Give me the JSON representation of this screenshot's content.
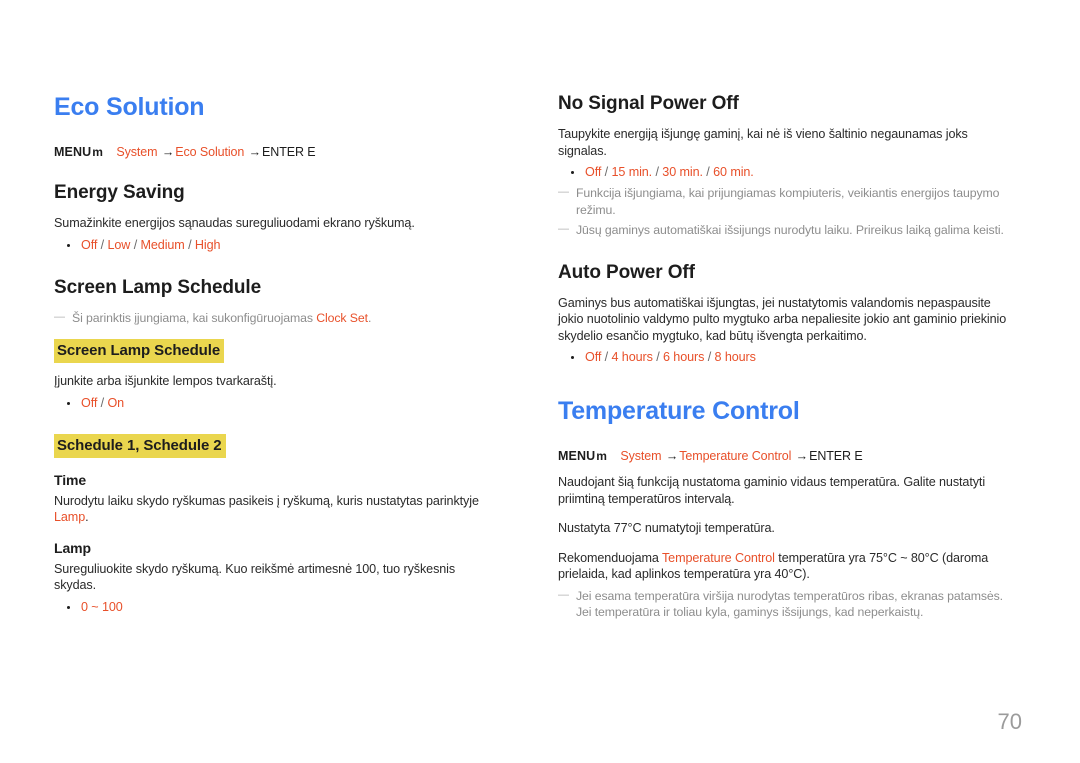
{
  "document": {
    "page_number": "70",
    "colors": {
      "chapter_blue": "#3a7ef0",
      "accent_orange": "#e8502a",
      "highlight_yellow": "#ead64e",
      "note_gray": "#8d8d8d",
      "page_number_gray": "#9b9b9b"
    }
  },
  "left_column": {
    "chapter_title": "Eco Solution",
    "menu_path": {
      "menu_label": "MENU",
      "menu_glyph": "m",
      "step1": "System",
      "arrow": "→",
      "step2": "Eco Solution",
      "enter": "ENTER E"
    },
    "energy_saving": {
      "heading": "Energy Saving",
      "body": "Sumažinkite energijos sąnaudas sureguliuodami ekrano ryškumą.",
      "options": [
        "Off",
        "Low",
        "Medium",
        "High"
      ]
    },
    "screen_lamp_schedule": {
      "heading": "Screen Lamp Schedule",
      "note": "Ši parinktis įjungiama, kai sukonfigūruojamas ",
      "note_accent": "Clock Set",
      "note_tail": ".",
      "sub1": {
        "heading": "Screen Lamp Schedule",
        "body": "Įjunkite arba išjunkite lempos tvarkaraštį.",
        "options": [
          "Off",
          "On"
        ]
      },
      "sub2": {
        "heading": "Schedule 1, Schedule 2",
        "time": {
          "heading": "Time",
          "body_pre": "Nurodytu laiku skydo ryškumas pasikeis į ryškumą, kuris nustatytas parinktyje ",
          "body_accent": "Lamp",
          "body_post": "."
        },
        "lamp": {
          "heading": "Lamp",
          "body": "Sureguliuokite skydo ryškumą. Kuo reikšmė artimesnė 100, tuo ryškesnis skydas.",
          "options": [
            "0 ~ 100"
          ]
        }
      }
    }
  },
  "right_column": {
    "no_signal_power_off": {
      "heading": "No Signal Power Off",
      "body": "Taupykite energiją išjungę gaminį, kai nė iš vieno šaltinio negaunamas joks signalas.",
      "options": [
        "Off",
        "15 min.",
        "30 min.",
        "60 min."
      ],
      "notes": [
        "Funkcija išjungiama, kai prijungiamas kompiuteris, veikiantis energijos taupymo režimu.",
        "Jūsų gaminys automatiškai išsijungs nurodytu laiku. Prireikus laiką galima keisti."
      ]
    },
    "auto_power_off": {
      "heading": "Auto Power Off",
      "body": "Gaminys bus automatiškai išjungtas, jei nustatytomis valandomis nepaspausite jokio nuotolinio valdymo pulto mygtuko arba nepaliesite jokio ant gaminio priekinio skydelio esančio mygtuko, kad būtų išvengta perkaitimo.",
      "options": [
        "Off",
        "4 hours",
        "6 hours",
        "8 hours"
      ]
    },
    "temperature_control": {
      "chapter_title": "Temperature Control",
      "menu_path": {
        "menu_label": "MENU",
        "menu_glyph": "m",
        "step1": "System",
        "arrow": "→",
        "step2": "Temperature Control",
        "enter": "ENTER E"
      },
      "body1": "Naudojant šią funkciją nustatoma gaminio vidaus temperatūra. Galite nustatyti priimtiną temperatūros intervalą.",
      "body2": "Nustatyta 77°C numatytoji temperatūra.",
      "body3_pre": "Rekomenduojama ",
      "body3_accent": "Temperature Control",
      "body3_post": " temperatūra yra 75°C ~ 80°C (daroma prielaida, kad aplinkos temperatūra yra 40°C).",
      "note": "Jei esama temperatūra viršija nurodytas temperatūros ribas, ekranas patamsės. Jei temperatūra ir toliau kyla, gaminys išsijungs, kad neperkaistų."
    }
  }
}
